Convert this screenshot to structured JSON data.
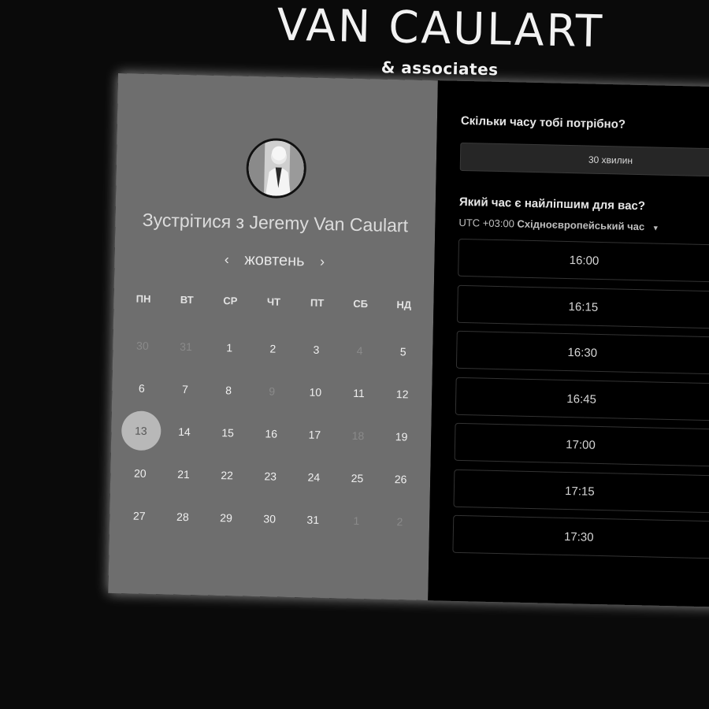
{
  "brand": {
    "name": "VAN CAULART",
    "sub": "& associates"
  },
  "host": {
    "title": "Зустрітися з Jeremy Van Caulart"
  },
  "calendar": {
    "month": "жовтень",
    "prev_icon": "‹",
    "next_icon": "›",
    "weekdays": [
      "ПН",
      "ВТ",
      "СР",
      "ЧТ",
      "ПТ",
      "СБ",
      "НД"
    ],
    "weeks": [
      [
        {
          "d": "30",
          "m": true
        },
        {
          "d": "31",
          "m": true
        },
        {
          "d": "1"
        },
        {
          "d": "2"
        },
        {
          "d": "3"
        },
        {
          "d": "4",
          "m": true
        },
        {
          "d": "5"
        }
      ],
      [
        {
          "d": "6"
        },
        {
          "d": "7"
        },
        {
          "d": "8"
        },
        {
          "d": "9",
          "m": true
        },
        {
          "d": "10"
        },
        {
          "d": "11"
        },
        {
          "d": "12"
        }
      ],
      [
        {
          "d": "13",
          "s": true
        },
        {
          "d": "14"
        },
        {
          "d": "15"
        },
        {
          "d": "16"
        },
        {
          "d": "17"
        },
        {
          "d": "18",
          "m": true
        },
        {
          "d": "19"
        }
      ],
      [
        {
          "d": "20"
        },
        {
          "d": "21"
        },
        {
          "d": "22"
        },
        {
          "d": "23"
        },
        {
          "d": "24"
        },
        {
          "d": "25"
        },
        {
          "d": "26"
        }
      ],
      [
        {
          "d": "27"
        },
        {
          "d": "28"
        },
        {
          "d": "29"
        },
        {
          "d": "30"
        },
        {
          "d": "31"
        },
        {
          "d": "1",
          "m": true
        },
        {
          "d": "2",
          "m": true
        }
      ]
    ]
  },
  "booking": {
    "duration_question": "Скільки часу тобі потрібно?",
    "duration_value": "30 хвилин",
    "time_question": "Який час є найліпшим для вас?",
    "timezone_offset": "UTC +03:00",
    "timezone_name": "Східноєвропейський час",
    "slots": [
      "16:00",
      "16:15",
      "16:30",
      "16:45",
      "17:00",
      "17:15",
      "17:30"
    ]
  }
}
